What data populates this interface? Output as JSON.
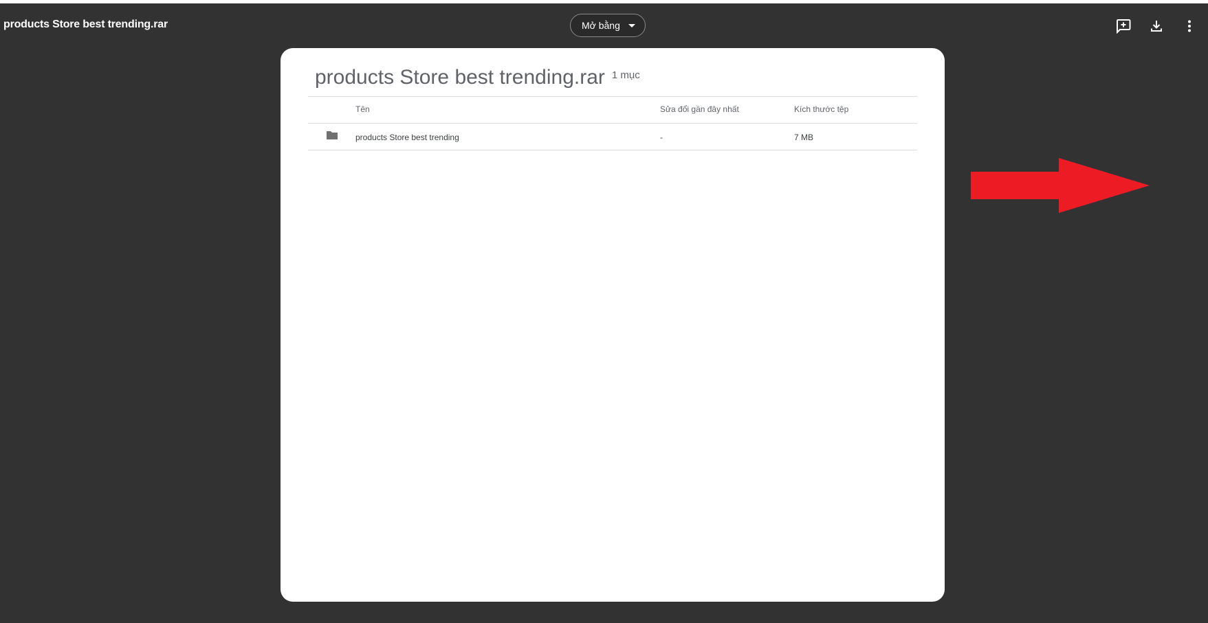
{
  "header": {
    "title": "products Store best trending.rar",
    "open_with_label": "Mở bằng",
    "icons": [
      "add-comment-icon",
      "download-icon",
      "more-vert-icon"
    ]
  },
  "panel": {
    "title": "products Store best trending.rar",
    "item_count": "1 mục"
  },
  "table": {
    "columns": [
      "Tên",
      "Sửa đổi gần đây nhất",
      "Kích thước tệp"
    ],
    "rows": [
      {
        "icon": "folder-icon",
        "name": "products Store best trending",
        "modified": "-",
        "size": "7 MB"
      }
    ]
  },
  "colors": {
    "background": "#323232",
    "panel": "#ffffff",
    "arrow": "#ed1c24"
  }
}
